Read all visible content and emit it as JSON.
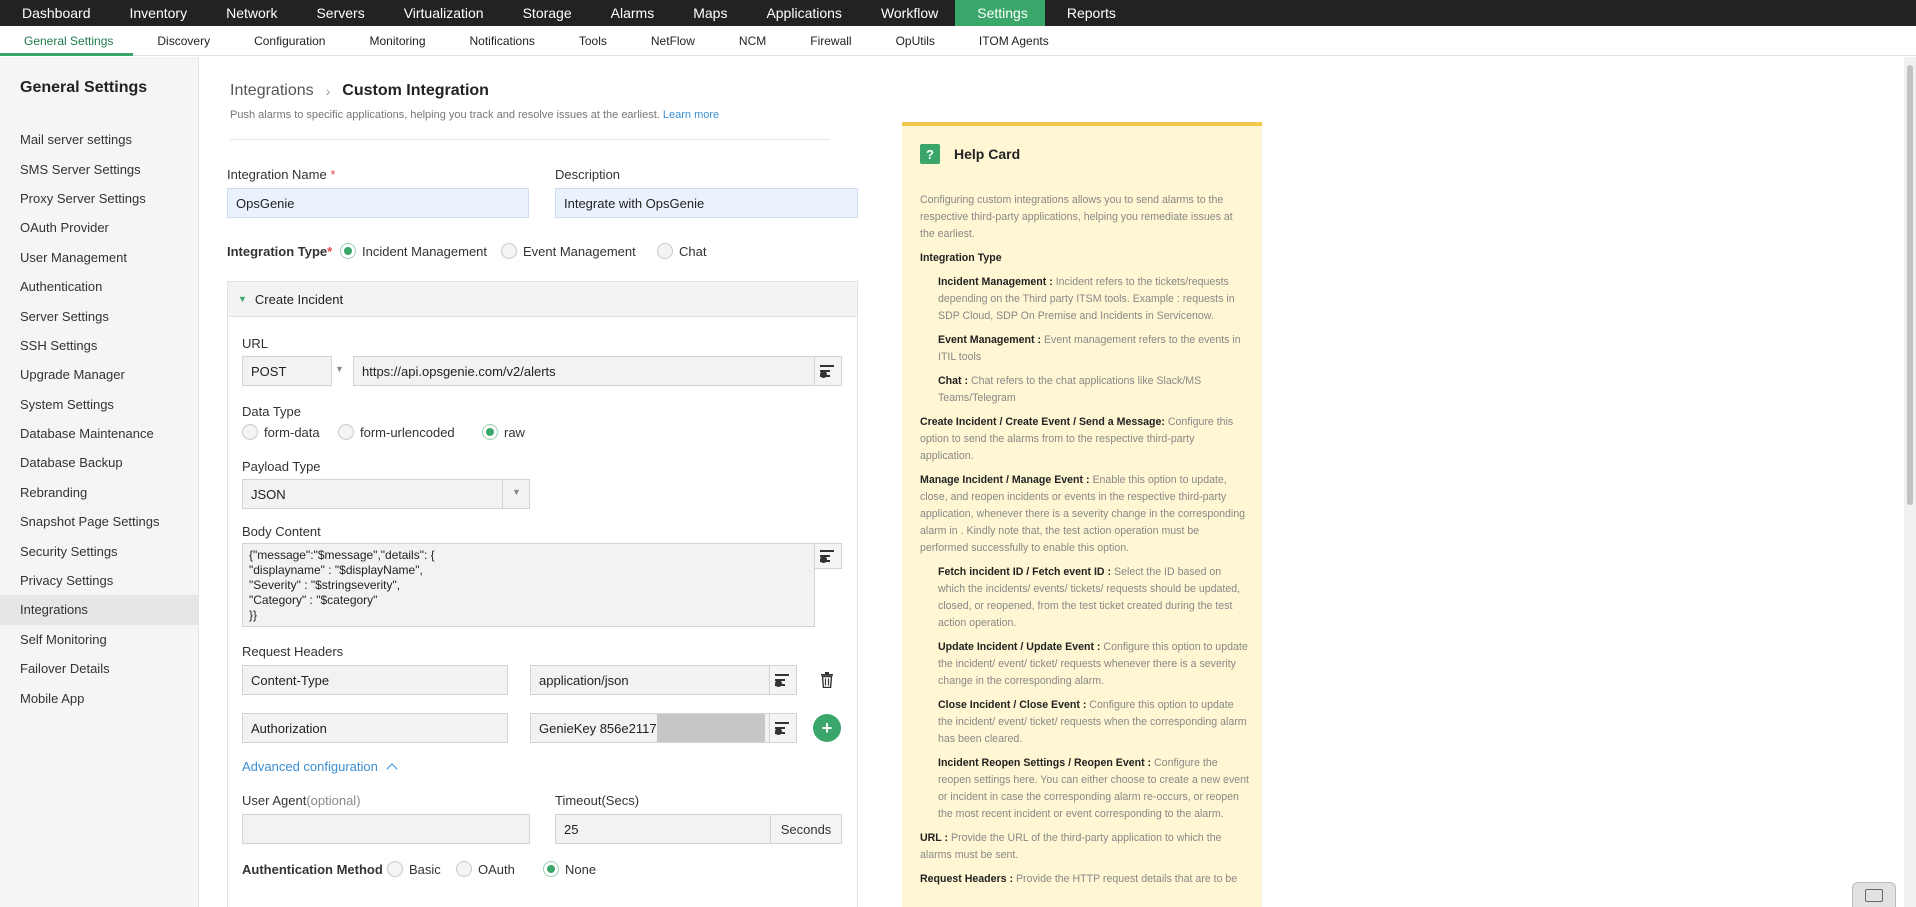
{
  "topnav": {
    "items": [
      "Dashboard",
      "Inventory",
      "Network",
      "Servers",
      "Virtualization",
      "Storage",
      "Alarms",
      "Maps",
      "Applications",
      "Workflow",
      "Settings",
      "Reports"
    ],
    "active": "Settings"
  },
  "subnav": {
    "items": [
      "General Settings",
      "Discovery",
      "Configuration",
      "Monitoring",
      "Notifications",
      "Tools",
      "NetFlow",
      "NCM",
      "Firewall",
      "OpUtils",
      "ITOM Agents"
    ],
    "active": "General Settings"
  },
  "sidebar": {
    "title": "General Settings",
    "items": [
      "Mail server settings",
      "SMS Server Settings",
      "Proxy Server Settings",
      "OAuth Provider",
      "User Management",
      "Authentication",
      "Server Settings",
      "SSH Settings",
      "Upgrade Manager",
      "System Settings",
      "Database Maintenance",
      "Database Backup",
      "Rebranding",
      "Snapshot Page Settings",
      "Security Settings",
      "Privacy Settings",
      "Integrations",
      "Self Monitoring",
      "Failover Details",
      "Mobile App"
    ],
    "active": "Integrations"
  },
  "breadcrumb": {
    "parent": "Integrations",
    "separator": "›",
    "current": "Custom Integration"
  },
  "subtitle": {
    "text": "Push alarms to specific applications, helping you track and resolve issues at the earliest.",
    "link": "Learn more"
  },
  "form": {
    "name_label": "Integration Name",
    "name_value": "OpsGenie",
    "desc_label": "Description",
    "desc_value": "Integrate with OpsGenie",
    "type_label": "Integration Type",
    "required_mark": "*",
    "types": [
      "Incident Management",
      "Event Management",
      "Chat"
    ],
    "type_selected": "Incident Management"
  },
  "create_incident": {
    "title": "Create Incident",
    "url_label": "URL",
    "method": "POST",
    "url_value": "https://api.opsgenie.com/v2/alerts",
    "data_type_label": "Data Type",
    "data_types": [
      "form-data",
      "form-urlencoded",
      "raw"
    ],
    "data_type_selected": "raw",
    "payload_label": "Payload Type",
    "payload_value": "JSON",
    "body_label": "Body Content",
    "body_lines": [
      "{\"message\":\"$message\",\"details\": {",
      "\"displayname\" : \"$displayName\",",
      "\"Severity\" : \"$stringseverity\",",
      "\"Category\" : \"$category\"",
      "}}"
    ],
    "headers_label": "Request Headers",
    "headers": [
      {
        "key": "Content-Type",
        "value": "application/json"
      },
      {
        "key": "Authorization",
        "value": "GenieKey 856e2117-"
      }
    ],
    "advanced_label": "Advanced configuration",
    "user_agent_label": "User Agent",
    "user_agent_hint": "(optional)",
    "user_agent_value": "",
    "timeout_label": "Timeout(Secs)",
    "timeout_value": "25",
    "timeout_unit": "Seconds",
    "auth_label": "Authentication Method",
    "auth_methods": [
      "Basic",
      "OAuth",
      "None"
    ],
    "auth_selected": "None"
  },
  "help": {
    "title": "Help Card",
    "icon_text": "?",
    "intro": "Configuring custom integrations allows you to send alarms to the respective third-party applications, helping you remediate issues at the earliest.",
    "section1": "Integration Type",
    "items": [
      {
        "k": "Incident Management :",
        "v": " Incident refers to the tickets/requests depending on the Third party ITSM tools. Example : requests in SDP Cloud, SDP On Premise and Incidents in Servicenow.",
        "indent": true
      },
      {
        "k": "Event Management :",
        "v": " Event management refers to the events in ITIL tools",
        "indent": true
      },
      {
        "k": "Chat :",
        "v": " Chat refers to the chat applications like Slack/MS Teams/Telegram",
        "indent": true
      },
      {
        "k": "Create Incident / Create Event / Send a Message:",
        "v": " Configure this option to send the alarms from  to the respective third-party application.",
        "indent": false
      },
      {
        "k": "Manage Incident / Manage Event :",
        "v": " Enable this option to update, close, and reopen incidents or events in the respective third-party application, whenever there is a severity change in the corresponding alarm in . Kindly note that, the test action operation must be performed successfully to enable this option.",
        "indent": false
      },
      {
        "k": "Fetch incident ID / Fetch event ID :",
        "v": " Select the ID based on which the incidents/ events/ tickets/ requests should be updated, closed, or reopened, from the test ticket created during the test action operation.",
        "indent": true
      },
      {
        "k": "Update Incident / Update Event :",
        "v": " Configure this option to update the incident/ event/ ticket/ requests whenever there is a severity change in the corresponding alarm.",
        "indent": true
      },
      {
        "k": "Close Incident / Close Event :",
        "v": " Configure this option to update the incident/ event/ ticket/ requests when the corresponding alarm has been cleared.",
        "indent": true
      },
      {
        "k": "Incident Reopen Settings / Reopen Event :",
        "v": " Configure the reopen settings here. You can either choose to create a new event or incident in case the corresponding alarm re-occurs, or reopen the most recent incident or event corresponding to the alarm.",
        "indent": true
      },
      {
        "k": "URL :",
        "v": "  Provide the URL of the third-party application to which the alarms must be sent.",
        "indent": false
      },
      {
        "k": "Request Headers :",
        "v": "  Provide the HTTP request details that are to be",
        "indent": false
      }
    ]
  }
}
